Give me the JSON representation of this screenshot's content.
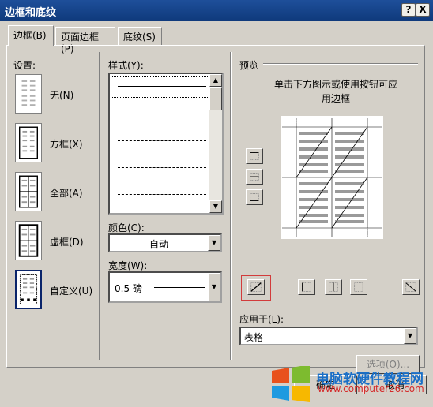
{
  "window": {
    "title": "边框和底纹",
    "help_btn": "?",
    "close_btn": "X"
  },
  "tabs": [
    {
      "label": "边框(B)",
      "active": true
    },
    {
      "label": "页面边框(P)",
      "active": false
    },
    {
      "label": "底纹(S)",
      "active": false
    }
  ],
  "settings": {
    "heading": "设置:",
    "items": [
      {
        "label": "无(N)"
      },
      {
        "label": "方框(X)"
      },
      {
        "label": "全部(A)"
      },
      {
        "label": "虚框(D)"
      },
      {
        "label": "自定义(U)"
      }
    ]
  },
  "style": {
    "heading": "样式(Y):",
    "lines": [
      "solid",
      "dotted",
      "dash-small",
      "dash",
      "dash-long"
    ]
  },
  "color": {
    "label": "颜色(C):",
    "value": "自动"
  },
  "width": {
    "label": "宽度(W):",
    "value": "0.5 磅"
  },
  "preview": {
    "heading": "预览",
    "hint": "单击下方图示或使用按钮可应用边框"
  },
  "apply_to": {
    "label": "应用于(L):",
    "value": "表格"
  },
  "buttons": {
    "options": "选项(O)...",
    "ok": "确定",
    "cancel": "取消"
  },
  "watermark": {
    "line1": "电脑软硬件教程网",
    "line2": "www.computer26.com"
  }
}
